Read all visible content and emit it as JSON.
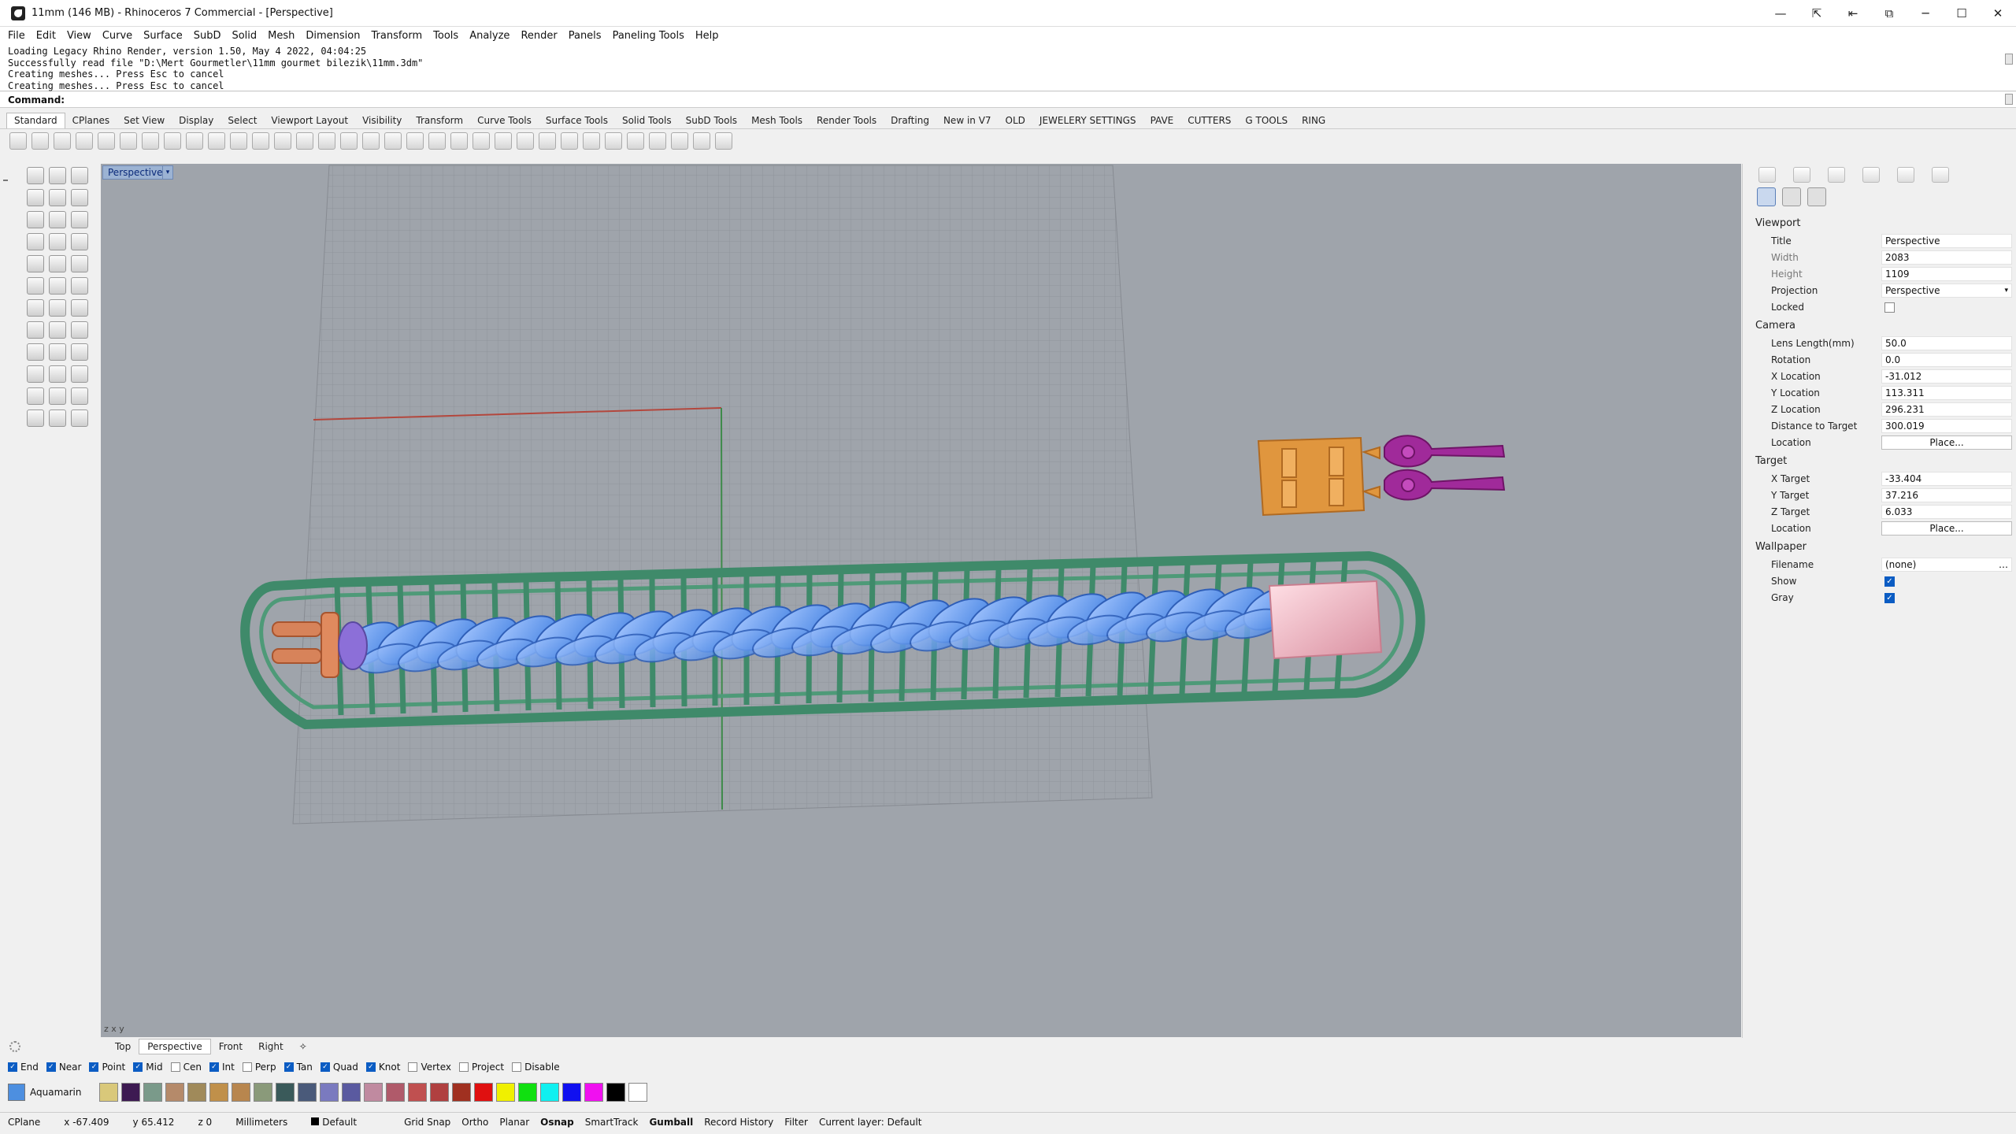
{
  "window": {
    "title": "11mm (146 MB) - Rhinoceros 7 Commercial - [Perspective]",
    "controls": [
      "—",
      "⇱",
      "⇤",
      "⧉",
      "─",
      "☐",
      "✕"
    ]
  },
  "menu": [
    "File",
    "Edit",
    "View",
    "Curve",
    "Surface",
    "SubD",
    "Solid",
    "Mesh",
    "Dimension",
    "Transform",
    "Tools",
    "Analyze",
    "Render",
    "Panels",
    "Paneling Tools",
    "Help"
  ],
  "command_history": [
    "Loading Legacy Rhino Render, version 1.50, May  4 2022, 04:04:25",
    "Successfully read file \"D:\\Mert Gourmetler\\11mm gourmet bilezik\\11mm.3dm\"",
    "Creating meshes... Press Esc to cancel",
    "Creating meshes... Press Esc to cancel"
  ],
  "command_prompt": "Command:",
  "toolbar_tabs": [
    "Standard",
    "CPlanes",
    "Set View",
    "Display",
    "Select",
    "Viewport Layout",
    "Visibility",
    "Transform",
    "Curve Tools",
    "Surface Tools",
    "Solid Tools",
    "SubD Tools",
    "Mesh Tools",
    "Render Tools",
    "Drafting",
    "New in V7",
    "OLD",
    "JEWELERY SETTINGS",
    "PAVE",
    "CUTTERS",
    "G TOOLS",
    "RING"
  ],
  "viewport": {
    "label": "Perspective",
    "axis_x": "x",
    "axis_y": "y",
    "axis_z": "z"
  },
  "view_tabs": [
    "Top",
    "Perspective",
    "Front",
    "Right"
  ],
  "osnaps": [
    {
      "label": "End",
      "checked": true
    },
    {
      "label": "Near",
      "checked": true
    },
    {
      "label": "Point",
      "checked": true
    },
    {
      "label": "Mid",
      "checked": true
    },
    {
      "label": "Cen",
      "checked": false
    },
    {
      "label": "Int",
      "checked": true
    },
    {
      "label": "Perp",
      "checked": false
    },
    {
      "label": "Tan",
      "checked": true
    },
    {
      "label": "Quad",
      "checked": true
    },
    {
      "label": "Knot",
      "checked": true
    },
    {
      "label": "Vertex",
      "checked": false
    },
    {
      "label": "Project",
      "checked": false
    },
    {
      "label": "Disable",
      "checked": false
    }
  ],
  "layer": {
    "current": "Aquamarin",
    "current_color": "#4d8fe0",
    "palette": [
      "#d9c87a",
      "#3d1a52",
      "#7a9a8a",
      "#b58a6a",
      "#a08a5a",
      "#c0904a",
      "#b8864e",
      "#8a9a7a",
      "#3a5a5a",
      "#4a5a7a",
      "#7a7abf",
      "#5a5aa0",
      "#c08aa0",
      "#b05a6a",
      "#c05050",
      "#b04040",
      "#a03020",
      "#e01010",
      "#f0f000",
      "#10e010",
      "#10f0f0",
      "#1010f0",
      "#f010f0",
      "#000000",
      "#ffffff"
    ]
  },
  "status": {
    "cplane": "CPlane",
    "x": "x -67.409",
    "y": "y 65.412",
    "z": "z 0",
    "units": "Millimeters",
    "layer": "Default",
    "panes": [
      "Grid Snap",
      "Ortho",
      "Planar",
      "Osnap",
      "SmartTrack",
      "Gumball",
      "Record History",
      "Filter"
    ],
    "current_layer": "Current layer: Default"
  },
  "properties": {
    "viewport_section": "Viewport",
    "title_label": "Title",
    "title_value": "Perspective",
    "width_label": "Width",
    "width_value": "2083",
    "height_label": "Height",
    "height_value": "1109",
    "projection_label": "Projection",
    "projection_value": "Perspective",
    "locked_label": "Locked",
    "camera_section": "Camera",
    "lens_label": "Lens Length(mm)",
    "lens_value": "50.0",
    "rotation_label": "Rotation",
    "rotation_value": "0.0",
    "xloc_label": "X Location",
    "xloc_value": "-31.012",
    "yloc_label": "Y Location",
    "yloc_value": "113.311",
    "zloc_label": "Z Location",
    "zloc_value": "296.231",
    "dist_label": "Distance to Target",
    "dist_value": "300.019",
    "location_label": "Location",
    "place_label": "Place...",
    "target_section": "Target",
    "xt_label": "X Target",
    "xt_value": "-33.404",
    "yt_label": "Y Target",
    "yt_value": "37.216",
    "zt_label": "Z Target",
    "zt_value": "6.033",
    "wallpaper_section": "Wallpaper",
    "filename_label": "Filename",
    "filename_value": "(none)",
    "show_label": "Show",
    "gray_label": "Gray"
  }
}
